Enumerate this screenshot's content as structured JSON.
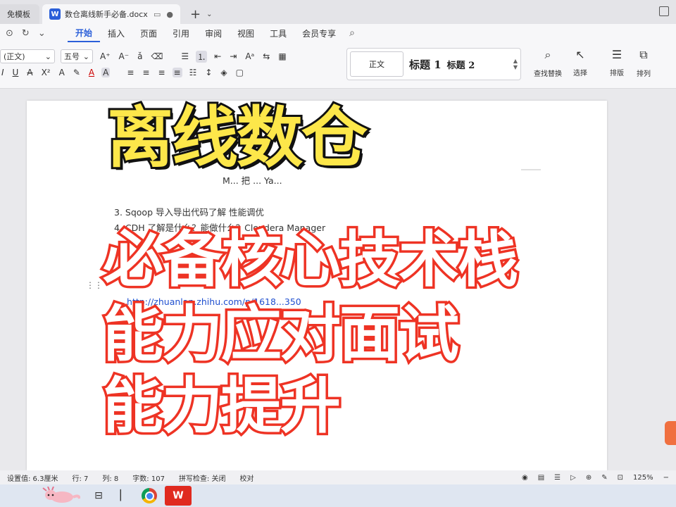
{
  "tabs": {
    "inactive_label": "免模板",
    "active_label": "数仓离线新手必备.docx",
    "doc_badge": "W"
  },
  "menu": {
    "items": [
      "开始",
      "插入",
      "页面",
      "引用",
      "审阅",
      "视图",
      "工具",
      "会员专享"
    ]
  },
  "ribbon": {
    "font_name": "(正文)",
    "font_size": "五号",
    "styles": {
      "normal": "正文",
      "h1": "标题 1",
      "h2": "标题 2"
    },
    "find_replace": "查找替换",
    "select": "选择",
    "layout": "排版",
    "arrange": "排列"
  },
  "document": {
    "lines": [
      "M... 把 ... Ya...",
      "3.  Sqoop    导入导出代码了解      性能调优",
      "4.  CDH       了解是什么？能做什么？Cloudera Manager",
      "http://zhuanlan.zhihu.com/p/1618...350"
    ]
  },
  "captions": {
    "title": "离线数仓",
    "line1": "必备核心技术栈",
    "line2": "能力应对面试",
    "line3": "能力提升"
  },
  "status": {
    "setting": "设置值: 6.3厘米",
    "row": "行: 7",
    "col": "列: 8",
    "words": "字数: 107",
    "spell": "拼写检查: 关闭",
    "proof": "校对",
    "zoom": "125%"
  },
  "taskbar": {
    "wps_label": "W"
  },
  "colors": {
    "accent": "#2b5fd9",
    "title_fill": "#fde74a",
    "caption_stroke": "#ee3324"
  }
}
